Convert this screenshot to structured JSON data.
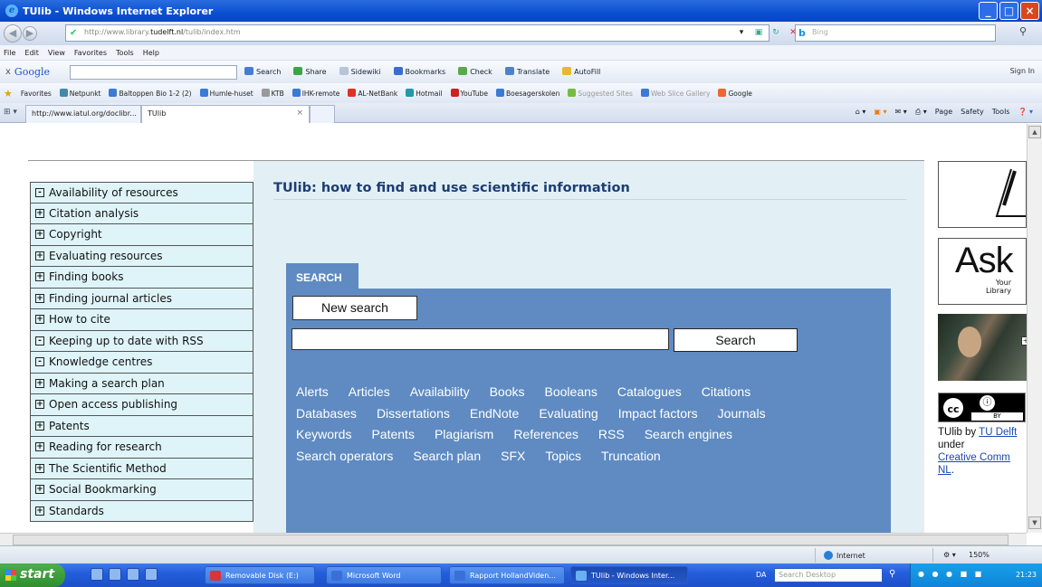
{
  "window": {
    "title": "TUlib - Windows Internet Explorer"
  },
  "address_bar": {
    "url_prefix": "http://www.library.",
    "url_domain": "tudelft.nl",
    "url_suffix": "/tulib/index.htm",
    "search_placeholder": "Bing",
    "search_logo": "b"
  },
  "menu": [
    "File",
    "Edit",
    "View",
    "Favorites",
    "Tools",
    "Help"
  ],
  "google_toolbar": {
    "close": "x",
    "logo": "Google",
    "items": [
      "Search",
      "Share",
      "Sidewiki",
      "Bookmarks",
      "Check",
      "Translate",
      "AutoFill"
    ],
    "signin": "Sign In"
  },
  "favorites_bar": {
    "label": "Favorites",
    "items": [
      "Netpunkt",
      "Baltoppen Bio 1-2 (2)",
      "Humle-huset",
      "KTB",
      "IHK-remote",
      "AL-NetBank",
      "Hotmail",
      "YouTube",
      "Boesagerskolen",
      "Suggested Sites",
      "Web Slice Gallery",
      "Google"
    ]
  },
  "tabs": {
    "tab1": "http://www.iatul.org/doclibr...",
    "tab2": "TUlib",
    "tools": [
      "Page",
      "Safety",
      "Tools"
    ]
  },
  "leftnav": {
    "items": [
      {
        "label": "Availability of resources",
        "icon": "-"
      },
      {
        "label": "Citation analysis",
        "icon": "+"
      },
      {
        "label": "Copyright",
        "icon": "+"
      },
      {
        "label": "Evaluating resources",
        "icon": "+"
      },
      {
        "label": "Finding books",
        "icon": "+"
      },
      {
        "label": "Finding journal articles",
        "icon": "+"
      },
      {
        "label": "How to cite",
        "icon": "+"
      },
      {
        "label": "Keeping up to date with RSS",
        "icon": "-"
      },
      {
        "label": "Knowledge centres",
        "icon": "-"
      },
      {
        "label": "Making a search plan",
        "icon": "+"
      },
      {
        "label": "Open access publishing",
        "icon": "+"
      },
      {
        "label": "Patents",
        "icon": "+"
      },
      {
        "label": "Reading for research",
        "icon": "+"
      },
      {
        "label": "The Scientific Method",
        "icon": "+"
      },
      {
        "label": "Social Bookmarking",
        "icon": "+"
      },
      {
        "label": "Standards",
        "icon": "+"
      }
    ]
  },
  "main": {
    "title": "TUlib: how to find and use scientific information",
    "search_tab": "SEARCH",
    "new_search": "New search",
    "search_button": "Search",
    "search_value": "",
    "topics": [
      "Alerts",
      "Articles",
      "Availability",
      "Books",
      "Booleans",
      "Catalogues",
      "Citations",
      "Databases",
      "Dissertations",
      "EndNote",
      "Evaluating",
      "Impact factors",
      "Journals",
      "Keywords",
      "Patents",
      "Plagiarism",
      "References",
      "RSS",
      "Search engines",
      "Search operators",
      "Search plan",
      "SFX",
      "Topics",
      "Truncation"
    ]
  },
  "right": {
    "ask_text": "Ask",
    "ask_sub1": "Your",
    "ask_sub2": "Library",
    "cc_label": "cc",
    "cc_by": "BY",
    "license_line1_a": "TUlib by ",
    "license_line1_link": "TU Delft",
    "license_line2": "under",
    "license_line3": "Creative Comm",
    "license_line4": "NL"
  },
  "status_bar": {
    "zone": "Internet",
    "zoom": "150%"
  },
  "taskbar": {
    "start": "start",
    "tasks": [
      "Removable Disk (E:)",
      "Microsoft Word",
      "Rapport HollandViden...",
      "TUlib - Windows Inter..."
    ],
    "da": "DA",
    "desktop_search": "Search Desktop",
    "clock": "21:23"
  }
}
